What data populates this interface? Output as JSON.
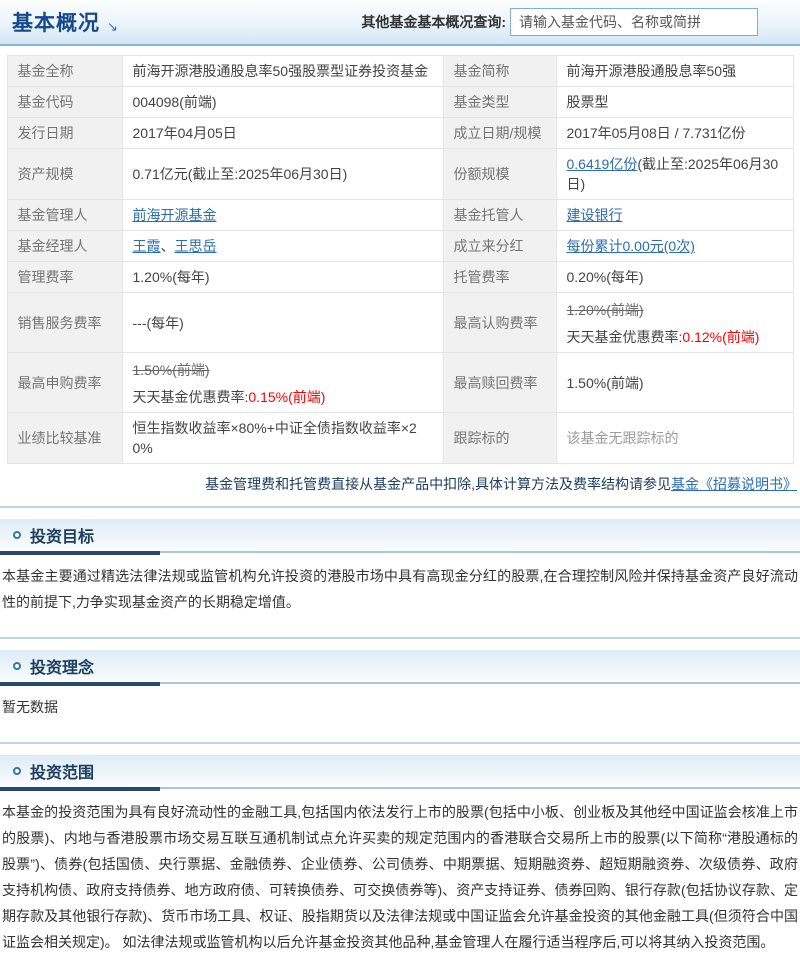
{
  "header": {
    "title": "基本概况",
    "arrow_glyph": "↘",
    "query_label": "其他基金基本概况查询:",
    "query_placeholder": "请输入基金代码、名称或简拼"
  },
  "info": {
    "full_name": {
      "label": "基金全称",
      "value": "前海开源港股通股息率50强股票型证券投资基金"
    },
    "short_name": {
      "label": "基金简称",
      "value": "前海开源港股通股息率50强"
    },
    "code": {
      "label": "基金代码",
      "value": "004098(前端)"
    },
    "type": {
      "label": "基金类型",
      "value": "股票型"
    },
    "issue_date": {
      "label": "发行日期",
      "value": "2017年04月05日"
    },
    "establish": {
      "label": "成立日期/规模",
      "value": "2017年05月08日 / 7.731亿份"
    },
    "asset_scale": {
      "label": "资产规模",
      "value": "0.71亿元(截止至:2025年06月30日)"
    },
    "share_scale": {
      "label": "份额规模",
      "link": "0.6419亿份",
      "suffix": "(截止至:2025年06月30日)"
    },
    "manager_company": {
      "label": "基金管理人",
      "link": "前海开源基金"
    },
    "custodian": {
      "label": "基金托管人",
      "link": "建设银行"
    },
    "fund_managers": {
      "label": "基金经理人",
      "link1": "王霞",
      "separator": "、",
      "link2": "王思岳"
    },
    "dividend": {
      "label": "成立来分红",
      "link": "每份累计0.00元(0次)"
    },
    "mgmt_fee": {
      "label": "管理费率",
      "value": "1.20%(每年)"
    },
    "custody_fee": {
      "label": "托管费率",
      "value": "0.20%(每年)"
    },
    "sales_fee": {
      "label": "销售服务费率",
      "value": "---(每年)"
    },
    "subscribe_fee": {
      "label": "最高认购费率",
      "original": "1.20%(前端)",
      "discount_label": "天天基金优惠费率:",
      "discount_value": "0.12%(前端)"
    },
    "purchase_fee": {
      "label": "最高申购费率",
      "original": "1.50%(前端)",
      "discount_label": "天天基金优惠费率:",
      "discount_value": "0.15%(前端)"
    },
    "redeem_fee": {
      "label": "最高赎回费率",
      "value": "1.50%(前端)"
    },
    "benchmark": {
      "label": "业绩比较基准",
      "value": "恒生指数收益率×80%+中证全债指数收益率×20%"
    },
    "tracking": {
      "label": "跟踪标的",
      "value": "该基金无跟踪标的"
    }
  },
  "note": {
    "text_prefix": "基金管理费和托管费直接从基金产品中扣除,具体计算方法及费率结构请参见",
    "link_text": "基金《招募说明书》"
  },
  "sections": {
    "goal": {
      "title": "投资目标",
      "body": "本基金主要通过精选法律法规或监管机构允许投资的港股市场中具有高现金分红的股票,在合理控制风险并保持基金资产良好流动性的前提下,力争实现基金资产的长期稳定增值。"
    },
    "philosophy": {
      "title": "投资理念",
      "body": "暂无数据"
    },
    "scope": {
      "title": "投资范围",
      "body": "本基金的投资范围为具有良好流动性的金融工具,包括国内依法发行上市的股票(包括中小板、创业板及其他经中国证监会核准上市的股票)、内地与香港股票市场交易互联互通机制试点允许买卖的规定范围内的香港联合交易所上市的股票(以下简称“港股通标的股票”)、债券(包括国债、央行票据、金融债券、企业债券、公司债券、中期票据、短期融资券、超短期融资券、次级债券、政府支持机构债、政府支持债券、地方政府债、可转换债券、可交换债券等)、资产支持证券、债券回购、银行存款(包括协议存款、定期存款及其他银行存款)、货币市场工具、权证、股指期货以及法律法规或中国证监会允许基金投资的其他金融工具(但须符合中国证监会相关规定)。 如法律法规或监管机构以后允许基金投资其他品种,基金管理人在履行适当程序后,可以将其纳入投资范围。"
    }
  },
  "colors": {
    "accent_blue": "#164a8c",
    "link_blue": "#2a6db5",
    "discount_red": "#ff0000",
    "section_navy": "#27496d"
  }
}
